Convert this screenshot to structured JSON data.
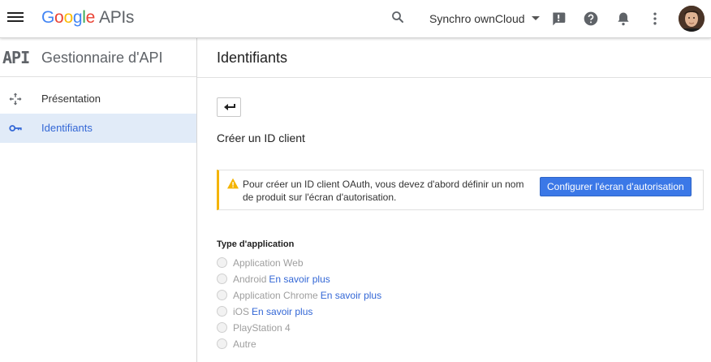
{
  "header": {
    "logo_letters": [
      "G",
      "o",
      "o",
      "g",
      "l",
      "e"
    ],
    "logo_product": "APIs",
    "project_name": "Synchro ownCloud",
    "icons": [
      "menu-icon",
      "search-icon",
      "feedback-icon",
      "help-icon",
      "notifications-icon",
      "more-vert-icon",
      "avatar"
    ]
  },
  "sidebar": {
    "api_mark": "API",
    "title": "Gestionnaire d'API",
    "items": [
      {
        "label": "Présentation",
        "icon": "overview-icon",
        "active": false
      },
      {
        "label": "Identifiants",
        "icon": "key-icon",
        "active": true
      }
    ]
  },
  "main": {
    "title": "Identifiants",
    "section_title": "Créer un ID client",
    "warning": {
      "text": "Pour créer un ID client OAuth, vous devez d'abord définir un nom de produit sur l'écran d'autorisation.",
      "button_label": "Configurer l'écran d'autorisation"
    },
    "app_type": {
      "label": "Type d'application",
      "options": [
        {
          "label": "Application Web",
          "link": ""
        },
        {
          "label": "Android",
          "link": "En savoir plus"
        },
        {
          "label": "Application Chrome",
          "link": "En savoir plus"
        },
        {
          "label": "iOS",
          "link": "En savoir plus"
        },
        {
          "label": "PlayStation 4",
          "link": ""
        },
        {
          "label": "Autre",
          "link": ""
        }
      ]
    }
  },
  "colors": {
    "accent": "#3b78e7",
    "link": "#3367d6",
    "active_nav_bg": "#e1ebf8",
    "warning": "#f4b400"
  }
}
